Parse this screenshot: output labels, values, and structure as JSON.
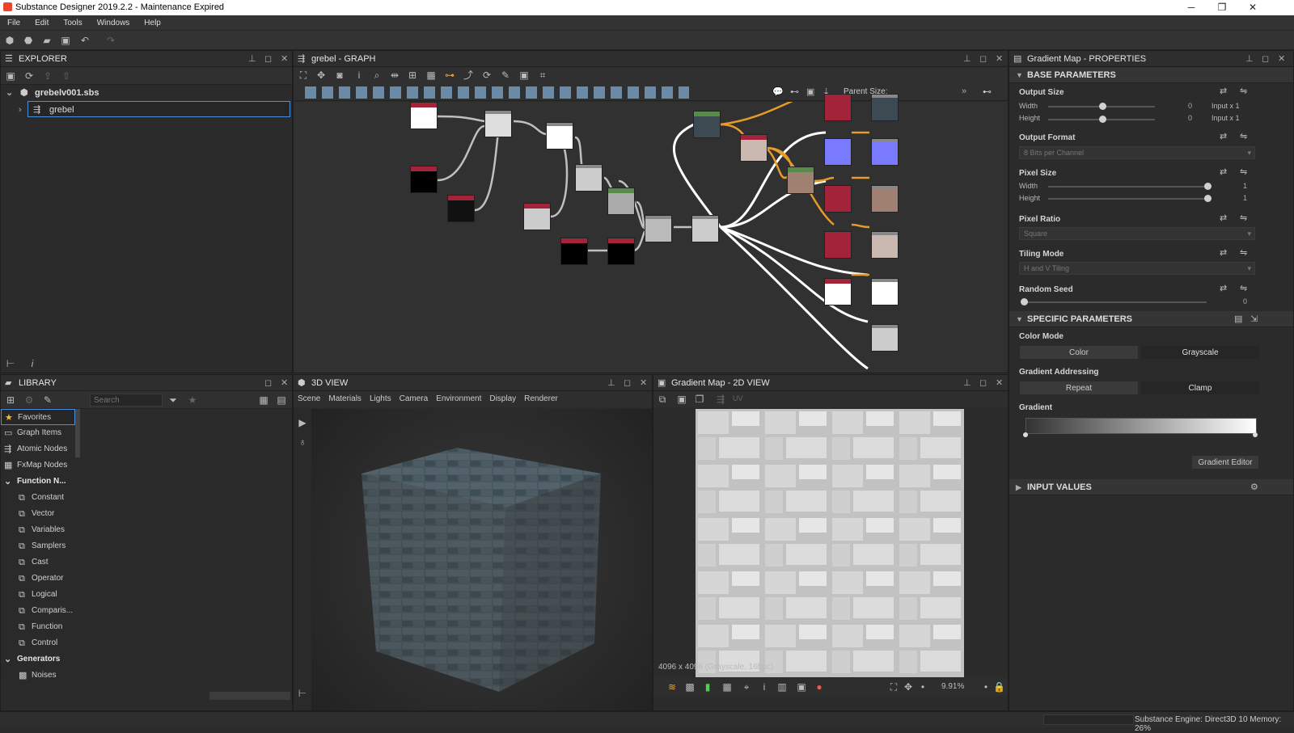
{
  "window": {
    "title": "Substance Designer 2019.2.2 - Maintenance Expired"
  },
  "menu": [
    "File",
    "Edit",
    "Tools",
    "Windows",
    "Help"
  ],
  "explorer": {
    "title": "EXPLORER",
    "package": "grebelv001.sbs",
    "graph": "grebel"
  },
  "graph": {
    "title": "grebel - GRAPH",
    "parent_size_label": "Parent Size:"
  },
  "library": {
    "title": "LIBRARY",
    "search_placeholder": "Search",
    "items": [
      "Favorites",
      "Graph Items",
      "Atomic Nodes",
      "FxMap Nodes",
      "Function N...",
      "Constant",
      "Vector",
      "Variables",
      "Samplers",
      "Cast",
      "Operator",
      "Logical",
      "Comparis...",
      "Function",
      "Control",
      "Generators",
      "Noises"
    ]
  },
  "view3d": {
    "title": "3D VIEW",
    "menu": [
      "Scene",
      "Materials",
      "Lights",
      "Camera",
      "Environment",
      "Display",
      "Renderer"
    ]
  },
  "view2d": {
    "title": "Gradient Map - 2D VIEW",
    "uv_label": "UV",
    "size_info": "4096 x 4096 (Grayscale, 16bpc)",
    "zoom": "9.91%"
  },
  "properties": {
    "title": "Gradient Map - PROPERTIES",
    "base_section": "BASE PARAMETERS",
    "output_size": {
      "label": "Output Size",
      "width_label": "Width",
      "height_label": "Height",
      "width_value": "0",
      "height_value": "0",
      "width_mode": "Input x 1",
      "height_mode": "Input x 1"
    },
    "output_format": {
      "label": "Output Format",
      "value": "8 Bits per Channel"
    },
    "pixel_size": {
      "label": "Pixel Size",
      "width_label": "Width",
      "height_label": "Height",
      "width_value": "1",
      "height_value": "1"
    },
    "pixel_ratio": {
      "label": "Pixel Ratio",
      "value": "Square"
    },
    "tiling_mode": {
      "label": "Tiling Mode",
      "value": "H and V Tiling"
    },
    "random_seed": {
      "label": "Random Seed",
      "value": "0"
    },
    "specific_section": "SPECIFIC PARAMETERS",
    "color_mode": {
      "label": "Color Mode",
      "options": [
        "Color",
        "Grayscale"
      ]
    },
    "gradient_addressing": {
      "label": "Gradient Addressing",
      "options": [
        "Repeat",
        "Clamp"
      ]
    },
    "gradient": {
      "label": "Gradient",
      "editor_button": "Gradient Editor"
    },
    "input_section": "INPUT VALUES"
  },
  "status": {
    "text": "Substance Engine: Direct3D 10  Memory: 26%"
  },
  "colors": {
    "accent": "#4a90d9",
    "bg": "#2b2b2b",
    "node_red": "#a3233a",
    "node_purple": "#7a7aff",
    "orange_wire": "#e89a2a"
  }
}
